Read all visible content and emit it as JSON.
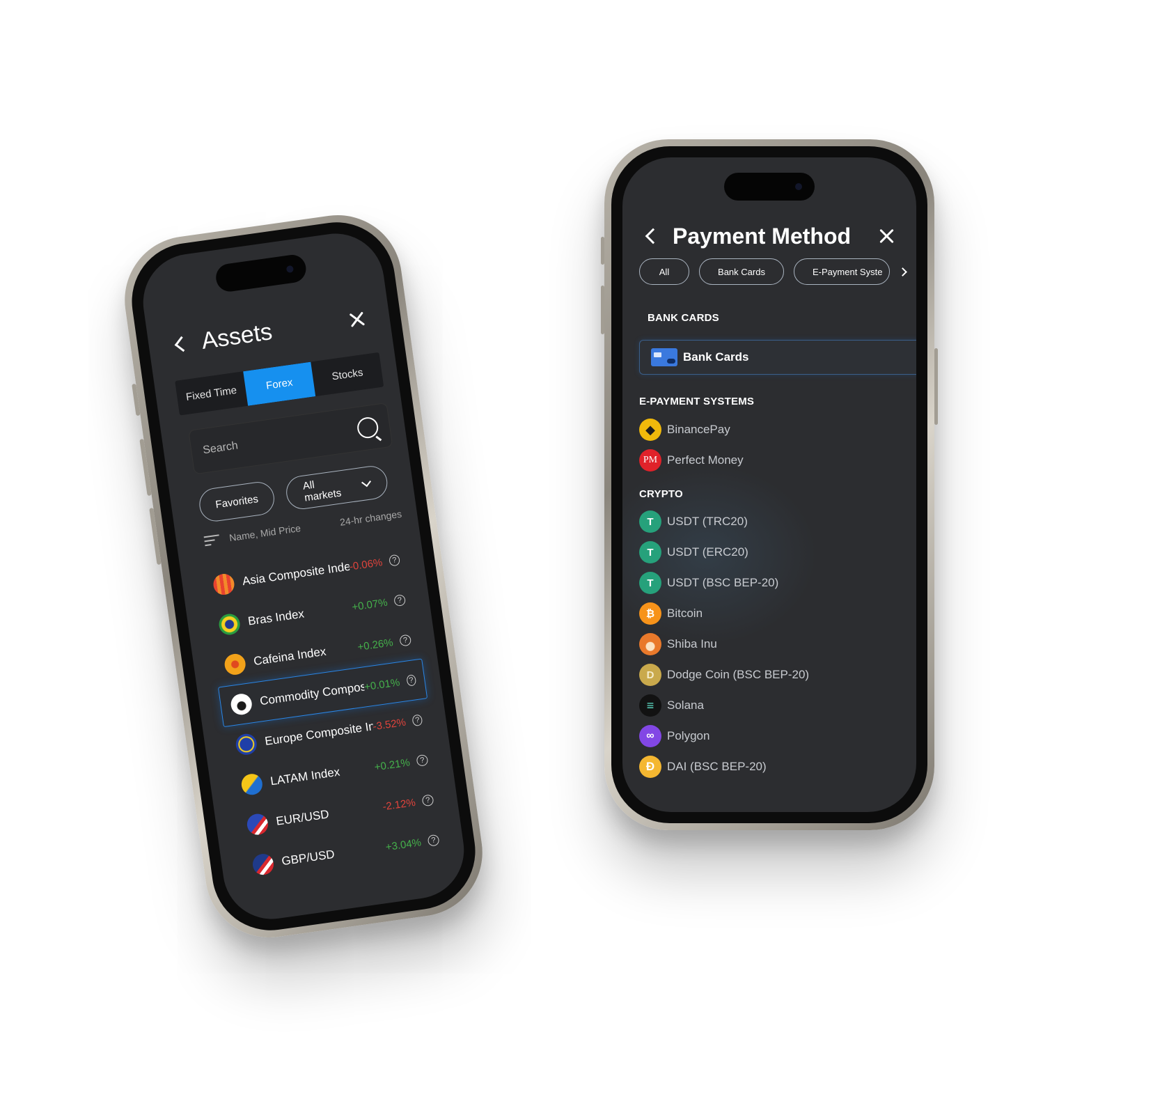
{
  "assets_screen": {
    "title": "Assets",
    "tabs": [
      "Fixed Time",
      "Forex",
      "Stocks"
    ],
    "active_tab": "Forex",
    "search_placeholder": "Search",
    "filters": {
      "favorites": "Favorites",
      "markets": "All markets"
    },
    "sort_label": "Name, Mid Price",
    "changes_label": "24-hr changes",
    "help_glyph": "?",
    "items": [
      {
        "name": "Asia Composite Index",
        "change": "-0.06%",
        "trend": "neg",
        "icon": "asia-flag-icon"
      },
      {
        "name": "Bras Index",
        "change": "+0.07%",
        "trend": "pos",
        "icon": "brazil-flag-icon"
      },
      {
        "name": "Cafeina Index",
        "change": "+0.26%",
        "trend": "pos",
        "icon": "coffee-bean-icon"
      },
      {
        "name": "Commodity Composite I.",
        "change": "+0.01%",
        "trend": "pos",
        "icon": "oil-drop-icon",
        "selected": true
      },
      {
        "name": "Europe Composite Index",
        "change": "-3.52%",
        "trend": "neg",
        "icon": "eu-flag-icon"
      },
      {
        "name": "LATAM Index",
        "change": "+0.21%",
        "trend": "pos",
        "icon": "latam-icon"
      },
      {
        "name": "EUR/USD",
        "change": "-2.12%",
        "trend": "neg",
        "icon": "eur-usd-flags-icon"
      },
      {
        "name": "GBP/USD",
        "change": "+3.04%",
        "trend": "pos",
        "icon": "gbp-usd-flags-icon"
      }
    ]
  },
  "payment_screen": {
    "title": "Payment Method",
    "chips": [
      "All",
      "Bank Cards",
      "E-Payment Syste"
    ],
    "sections": {
      "bank_cards": "BANK CARDS",
      "e_payment": "E-PAYMENT SYSTEMS",
      "crypto": "CRYPTO"
    },
    "bank_card_item": "Bank Cards",
    "e_payment_items": [
      {
        "label": "BinancePay",
        "icon": "binance-icon"
      },
      {
        "label": "Perfect Money",
        "icon": "perfect-money-icon"
      }
    ],
    "crypto_items": [
      {
        "label": "USDT (TRC20)",
        "icon": "tether-icon"
      },
      {
        "label": "USDT (ERC20)",
        "icon": "tether-icon"
      },
      {
        "label": "USDT (BSC BEP-20)",
        "icon": "tether-icon"
      },
      {
        "label": "Bitcoin",
        "icon": "bitcoin-icon"
      },
      {
        "label": "Shiba Inu",
        "icon": "shiba-inu-icon"
      },
      {
        "label": "Dodge Coin (BSC BEP-20)",
        "icon": "dogecoin-icon"
      },
      {
        "label": "Solana",
        "icon": "solana-icon"
      },
      {
        "label": "Polygon",
        "icon": "polygon-icon"
      },
      {
        "label": "DAI (BSC BEP-20)",
        "icon": "dai-icon"
      }
    ]
  },
  "colors": {
    "accent": "#1690ef",
    "positive": "#45b14b",
    "negative": "#e0443c",
    "screen_bg": "#2c2d30"
  }
}
